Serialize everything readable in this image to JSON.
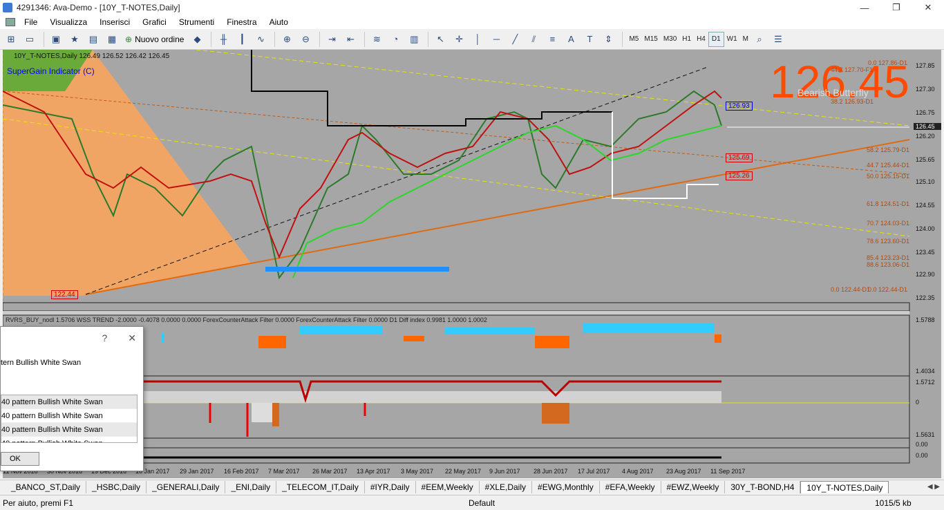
{
  "window": {
    "title": "4291346: Ava-Demo - [10Y_T-NOTES,Daily]",
    "min": "—",
    "max": "❐",
    "close": "✕"
  },
  "menu": [
    "File",
    "Visualizza",
    "Inserisci",
    "Grafici",
    "Strumenti",
    "Finestra",
    "Aiuto"
  ],
  "toolbar": {
    "new_order": "Nuovo ordine"
  },
  "timeframes": [
    "M5",
    "M15",
    "M30",
    "H1",
    "H4",
    "D1",
    "W1",
    "M"
  ],
  "active_timeframe": "D1",
  "chart": {
    "ohlc_line": "10Y_T-NOTES,Daily  126.49 126.52 126.42 126.45",
    "indicator_name": "SuperGain Indicator (C)",
    "big_price": "126.45",
    "pattern_label": "Bearish Butterfly",
    "current_price": "126.45",
    "price_ticks": [
      "127.85",
      "127.30",
      "126.75",
      "126.20",
      "125.65",
      "125.10",
      "124.55",
      "124.00",
      "123.45",
      "122.90",
      "122.35"
    ],
    "sub_ticks": [
      "1.5788",
      "1.4034",
      "1.5712",
      "0",
      "1.5631",
      "0.00",
      "0.00"
    ],
    "level_labels": [
      "126.93",
      "125.69",
      "125.26",
      "122.44"
    ],
    "fib_labels": [
      "0.0 127.86-D1",
      "44.7 127.70-F1",
      "38.2 126.93-D1",
      "58.2 125.79-D1",
      "44.7 125.44-D1",
      "50.0 125.15-D1",
      "61.8 124.51-D1",
      "70.7 124.03-D1",
      "78.6 123.60-D1",
      "85.4 123.23-D1",
      "88.6 123.06-D1",
      "0.0 122.44-D1",
      "0.0 122.44-D1"
    ],
    "subwindow_text": "RVRS_BUY_nodl  1.5706  WSS TREND -2.0000 -0.4078 0.0000 0.0000  ForexCounterAttack Filter 0.0000  ForexCounterAttack Filter 0.0000  D1 Diff index 0.9981 1.0000 1.0002",
    "dates": [
      "11 Nov 2016",
      "30 Nov 2016",
      "19 Dec 2016",
      "10 Jan 2017",
      "29 Jan 2017",
      "16 Feb 2017",
      "7 Mar 2017",
      "26 Mar 2017",
      "13 Apr 2017",
      "3 May 2017",
      "22 May 2017",
      "9 Jun 2017",
      "28 Jun 2017",
      "17 Jul 2017",
      "4 Aug 2017",
      "23 Aug 2017",
      "11 Sep 2017"
    ]
  },
  "dialog": {
    "help": "?",
    "close": "✕",
    "message": "tern Bullish White Swan",
    "items": [
      "40 pattern Bullish White Swan",
      "40 pattern Bullish White Swan",
      "40 pattern Bullish White Swan",
      "40 pattern Bullish White Swan"
    ],
    "ok": "OK"
  },
  "tabs": [
    "_BANCO_ST,Daily",
    "_HSBC,Daily",
    "_GENERALI,Daily",
    "_ENI,Daily",
    "_TELECOM_IT,Daily",
    "#IYR,Daily",
    "#EEM,Weekly",
    "#XLE,Daily",
    "#EWG,Monthly",
    "#EFA,Weekly",
    "#EWZ,Weekly",
    "30Y_T-BOND,H4",
    "10Y_T-NOTES,Daily"
  ],
  "active_tab": "10Y_T-NOTES,Daily",
  "status": {
    "help": "Per aiuto, premi F1",
    "profile": "Default",
    "traffic": "1015/5 kb"
  },
  "colors": {
    "big_price": "#ff4a00",
    "chart_bg": "#a6a6a6",
    "fib": "#b04a10"
  }
}
